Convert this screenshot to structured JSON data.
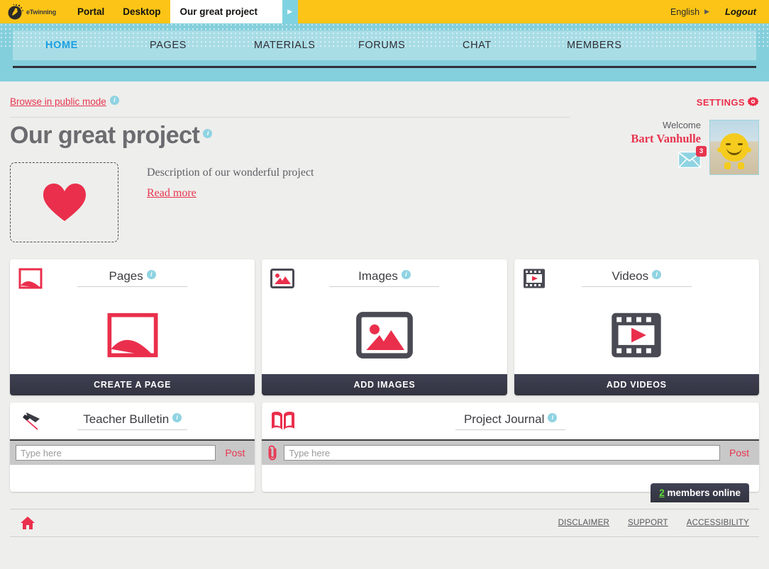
{
  "topbar": {
    "logo_text": "eTwinning",
    "links": [
      {
        "label": "Portal"
      },
      {
        "label": "Desktop"
      }
    ],
    "active_tab": "Our great project",
    "tab_arrow": "▶",
    "language": "English",
    "language_arrow": "▶",
    "logout": "Logout"
  },
  "mainnav": {
    "items": [
      {
        "label": "HOME",
        "active": true
      },
      {
        "label": "PAGES",
        "active": false
      },
      {
        "label": "MATERIALS",
        "active": false
      },
      {
        "label": "FORUMS",
        "active": false
      },
      {
        "label": "CHAT",
        "active": false
      },
      {
        "label": "MEMBERS",
        "active": false
      }
    ]
  },
  "toolbar": {
    "browse_public": "Browse in public mode",
    "settings_label": "SETTINGS"
  },
  "project": {
    "title": "Our great project",
    "description": "Description of our wonderful project",
    "read_more": "Read more"
  },
  "user": {
    "welcome_label": "Welcome",
    "name": "Bart Vanhulle",
    "mail_count": "3"
  },
  "cards": [
    {
      "title": "Pages",
      "button": "CREATE A PAGE",
      "icon": "page-icon"
    },
    {
      "title": "Images",
      "button": "ADD IMAGES",
      "icon": "image-icon"
    },
    {
      "title": "Videos",
      "button": "ADD VIDEOS",
      "icon": "video-icon"
    }
  ],
  "bulletin": {
    "title": "Teacher Bulletin",
    "placeholder": "Type here",
    "post": "Post"
  },
  "journal": {
    "title": "Project Journal",
    "placeholder": "Type here",
    "post": "Post"
  },
  "footer": {
    "online_count": "2",
    "online_label": "members online",
    "links": [
      {
        "label": "DISCLAIMER"
      },
      {
        "label": "SUPPORT"
      },
      {
        "label": "ACCESSIBILITY"
      }
    ]
  },
  "colors": {
    "brand_yellow": "#fcc416",
    "teal": "#84cfdc",
    "red": "#e8344e",
    "dark": "#32343f",
    "info_blue": "#8fd3e2",
    "online_green": "#5fe03a"
  },
  "info_icon_glyph": "i"
}
